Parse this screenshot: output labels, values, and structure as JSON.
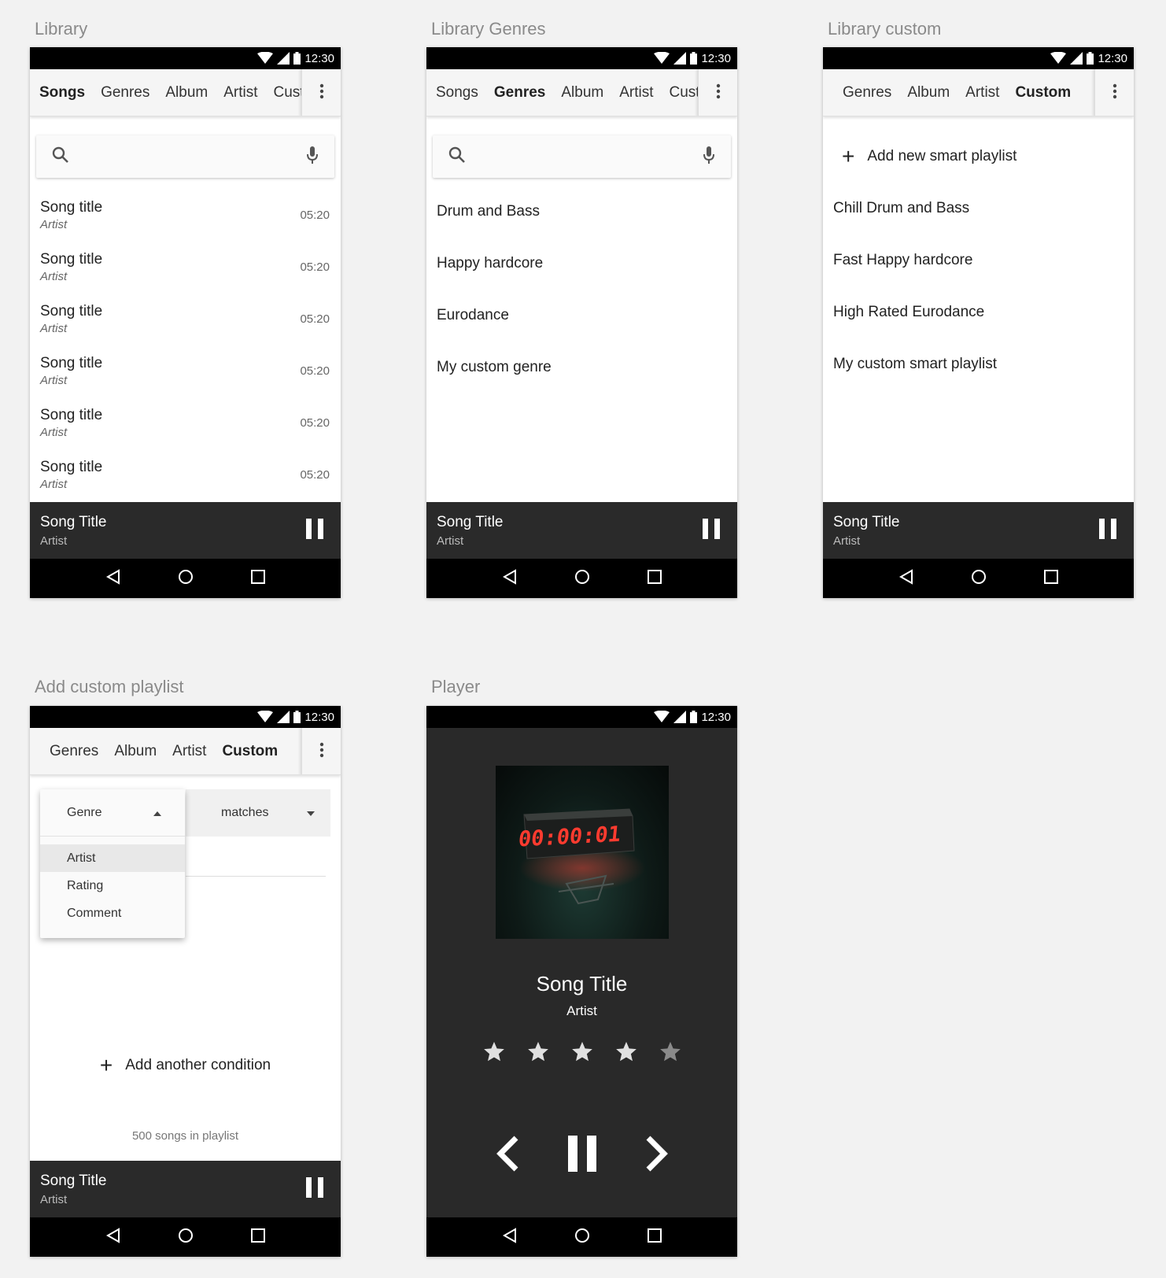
{
  "status_time": "12:30",
  "labels": {
    "library": "Library",
    "library_genres": "Library Genres",
    "library_custom": "Library custom",
    "add_custom": "Add custom playlist",
    "player": "Player"
  },
  "tabs_full": [
    "Songs",
    "Genres",
    "Album",
    "Artist",
    "Custom"
  ],
  "tabs_custom": [
    "Genres",
    "Album",
    "Artist",
    "Custom"
  ],
  "songs": [
    {
      "title": "Song title",
      "artist": "Artist",
      "duration": "05:20"
    },
    {
      "title": "Song title",
      "artist": "Artist",
      "duration": "05:20"
    },
    {
      "title": "Song title",
      "artist": "Artist",
      "duration": "05:20"
    },
    {
      "title": "Song title",
      "artist": "Artist",
      "duration": "05:20"
    },
    {
      "title": "Song title",
      "artist": "Artist",
      "duration": "05:20"
    },
    {
      "title": "Song title",
      "artist": "Artist",
      "duration": "05:20"
    }
  ],
  "genres": [
    "Drum and Bass",
    "Happy hardcore",
    "Eurodance",
    "My custom genre"
  ],
  "custom": {
    "add_label": "Add new smart playlist",
    "playlists": [
      "Chill Drum and Bass",
      "Fast Happy hardcore",
      "High Rated Eurodance",
      "My custom smart playlist"
    ]
  },
  "mini_player": {
    "title": "Song Title",
    "artist": "Artist"
  },
  "condition": {
    "field": "Genre",
    "options": [
      "Artist",
      "Rating",
      "Comment"
    ],
    "operator": "matches",
    "add_label": "Add another condition",
    "count_text": "500 songs in playlist"
  },
  "player": {
    "title": "Song Title",
    "artist": "Artist",
    "rating": 4,
    "max_rating": 5,
    "clock_text": "00:00:01"
  },
  "colors": {
    "star_on": "#e0e0e0",
    "star_off": "#8a8a8a",
    "clock_red": "#ff3b2f"
  }
}
